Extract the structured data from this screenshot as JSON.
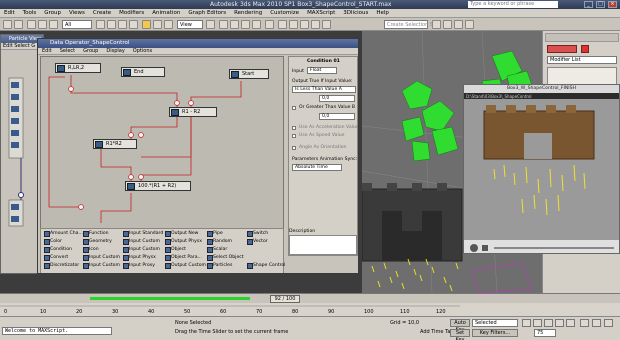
{
  "window": {
    "title": "Autodesk 3ds Max 2010 SP1    Box3_ShapeControl_START.max",
    "search_placeholder": "Type a keyword or phrase"
  },
  "menu": [
    "Edit",
    "Tools",
    "Group",
    "Views",
    "Create",
    "Modifiers",
    "Animation",
    "Graph Editors",
    "Rendering",
    "Customize",
    "MAXScript",
    "3Dlicious",
    "Help"
  ],
  "toolbar": {
    "selection_filter": "All",
    "ref_coord": "View",
    "named_sel_placeholder": "Create Selection Se"
  },
  "particle_view": {
    "title": "Particle View",
    "menu": "Edit  Select  G"
  },
  "data_operator": {
    "title": "Data Operator_ShapeControl",
    "menu": [
      "Edit",
      "Select",
      "Group",
      "Display",
      "Options"
    ],
    "nodes": {
      "n1": "R,LR,2",
      "n2": "End",
      "n3": "Start",
      "n4": "R1 - R2",
      "n5": "R1*R2",
      "n6": "100.*(R1 + R2)"
    }
  },
  "condition": {
    "title": "Condition 01",
    "input_label": "Input",
    "input_value": "Float",
    "output_title": "Output True If Input Value:",
    "mode": "Is Less Than Value A",
    "value_a": "0,0",
    "or_greater": "Or Greater Than Value B",
    "value_b": "0,0",
    "use_accel": "Use As Acceleration Value",
    "use_speed": "Use As Speed Value",
    "angle_orientation": "Angle As Orientation",
    "sync_title": "Parameters Animation Sync:",
    "sync_value": "Absolute Time",
    "description": "Description"
  },
  "palette": [
    [
      "Amount Cha...",
      "Function",
      "Input Standard",
      "Output New",
      "Pipe",
      "Switch"
    ],
    [
      "Color",
      "Geometry",
      "Input Custom",
      "Output Physx",
      "Random",
      "Vector"
    ],
    [
      "Condition",
      "Icon",
      "Input Custom",
      "Object",
      "Scalar",
      ""
    ],
    [
      "Convert",
      "Input Custom",
      "Input Physx",
      "Object Para...",
      "Select Object",
      ""
    ],
    [
      "Discretizator",
      "Input Custom",
      "Input Proxy",
      "Output Custom",
      "Particles",
      "Shape Control"
    ]
  ],
  "command_panel": {
    "modifier_list": "Modifier List"
  },
  "preview": {
    "title": "Box3_W_ShapeControl_FINISH",
    "filename": "D:\\Stand\\03\\Box3\\_ShapeControl"
  },
  "timeline": {
    "frame": "92 / 100",
    "ticks": [
      "0",
      "10",
      "20",
      "30",
      "40",
      "50",
      "60",
      "70",
      "80",
      "90",
      "100",
      "110",
      "120"
    ]
  },
  "status": {
    "maxscript": "Welcome to MAXScript.",
    "selection": "None Selected",
    "prompt": "Drag the Time Slider to set the current frame",
    "grid": "Grid = 10,0",
    "autokey": "Auto Key",
    "selected": "Selected",
    "setkey": "Set Key",
    "keyfilters": "Key Filters...",
    "add_time_tag": "Add Time Tag",
    "frame_value": "75"
  }
}
